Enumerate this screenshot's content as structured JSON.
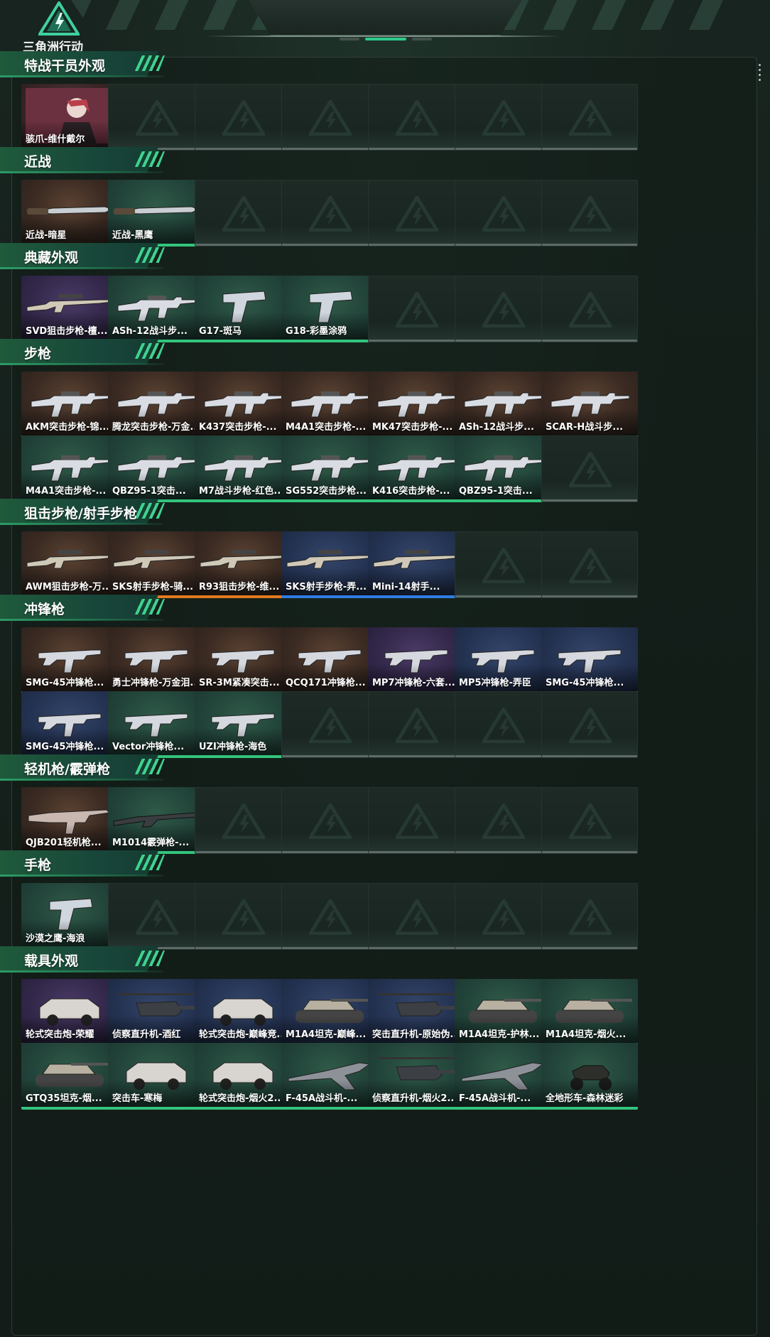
{
  "header": {
    "logo_text": "三角洲行动"
  },
  "colors": {
    "orange": "#e27a1f",
    "red": "#d2303b",
    "purple": "#8a4de0",
    "blue": "#2f7de6",
    "green": "#33c47d",
    "accent": "#2dc98a"
  },
  "sections": [
    {
      "title": "特战干员外观",
      "rows": [
        [
          {
            "label": "骇爪-维什戴尔",
            "q": "red",
            "icon": "operator-portrait"
          },
          null,
          null,
          null,
          null,
          null,
          null
        ]
      ]
    },
    {
      "title": "近战",
      "rows": [
        [
          {
            "label": "近战-暗星",
            "q": "orange",
            "icon": "knife"
          },
          {
            "label": "近战-黑鹰",
            "q": "green",
            "icon": "knife"
          },
          null,
          null,
          null,
          null,
          null
        ]
      ]
    },
    {
      "title": "典藏外观",
      "rows": [
        [
          {
            "label": "SVD狙击步枪-檀...",
            "q": "purple",
            "icon": "sniper-rifle"
          },
          {
            "label": "ASh-12战斗步...",
            "q": "green",
            "icon": "rifle"
          },
          {
            "label": "G17-斑马",
            "q": "green",
            "icon": "pistol"
          },
          {
            "label": "G18-彩墨涂鸦",
            "q": "green",
            "icon": "pistol"
          },
          null,
          null,
          null
        ]
      ]
    },
    {
      "title": "步枪",
      "rows": [
        [
          {
            "label": "AKM突击步枪-锦...",
            "q": "orange",
            "icon": "rifle"
          },
          {
            "label": "腾龙突击步枪-万金...",
            "q": "orange",
            "icon": "rifle"
          },
          {
            "label": "K437突击步枪-...",
            "q": "orange",
            "icon": "rifle"
          },
          {
            "label": "M4A1突击步枪-...",
            "q": "orange",
            "icon": "rifle"
          },
          {
            "label": "MK47突击步枪-...",
            "q": "orange",
            "icon": "rifle"
          },
          {
            "label": "ASh-12战斗步...",
            "q": "orange",
            "icon": "rifle"
          },
          {
            "label": "SCAR-H战斗步...",
            "q": "orange",
            "icon": "rifle"
          }
        ],
        [
          {
            "label": "M4A1突击步枪-...",
            "q": "green",
            "icon": "rifle"
          },
          {
            "label": "QBZ95-1突击...",
            "q": "green",
            "icon": "rifle"
          },
          {
            "label": "M7战斗步枪-红色...",
            "q": "green",
            "icon": "rifle"
          },
          {
            "label": "SG552突击步枪...",
            "q": "green",
            "icon": "rifle"
          },
          {
            "label": "K416突击步枪-...",
            "q": "green",
            "icon": "rifle"
          },
          {
            "label": "QBZ95-1突击...",
            "q": "green",
            "icon": "rifle"
          },
          null
        ]
      ]
    },
    {
      "title": "狙击步枪/射手步枪",
      "rows": [
        [
          {
            "label": "AWM狙击步枪-万...",
            "q": "orange",
            "icon": "sniper-rifle"
          },
          {
            "label": "SKS射手步枪-骑...",
            "q": "orange",
            "icon": "sniper-rifle"
          },
          {
            "label": "R93狙击步枪-维...",
            "q": "orange",
            "icon": "sniper-rifle"
          },
          {
            "label": "SKS射手步枪-弄...",
            "q": "blue",
            "icon": "sniper-rifle"
          },
          {
            "label": "Mini-14射手...",
            "q": "blue",
            "icon": "sniper-rifle"
          },
          null,
          null
        ]
      ]
    },
    {
      "title": "冲锋枪",
      "rows": [
        [
          {
            "label": "SMG-45冲锋枪...",
            "q": "orange",
            "icon": "smg"
          },
          {
            "label": "勇士冲锋枪-万金泪...",
            "q": "orange",
            "icon": "smg"
          },
          {
            "label": "SR-3M紧凑突击...",
            "q": "orange",
            "icon": "smg"
          },
          {
            "label": "QCQ171冲锋枪...",
            "q": "orange",
            "icon": "smg"
          },
          {
            "label": "MP7冲锋枪-六套...",
            "q": "purple",
            "icon": "smg"
          },
          {
            "label": "MP5冲锋枪-弄臣",
            "q": "blue",
            "icon": "smg"
          },
          {
            "label": "SMG-45冲锋枪...",
            "q": "blue",
            "icon": "smg"
          }
        ],
        [
          {
            "label": "SMG-45冲锋枪...",
            "q": "blue",
            "icon": "smg"
          },
          {
            "label": "Vector冲锋枪...",
            "q": "green",
            "icon": "smg"
          },
          {
            "label": "UZI冲锋枪-海色",
            "q": "green",
            "icon": "smg"
          },
          null,
          null,
          null,
          null
        ]
      ]
    },
    {
      "title": "轻机枪/霰弹枪",
      "rows": [
        [
          {
            "label": "QJB201轻机枪...",
            "q": "orange",
            "icon": "lmg"
          },
          {
            "label": "M1014霰弹枪-...",
            "q": "green",
            "icon": "shotgun"
          },
          null,
          null,
          null,
          null,
          null
        ]
      ]
    },
    {
      "title": "手枪",
      "rows": [
        [
          {
            "label": "沙漠之鹰-海浪",
            "q": "green",
            "icon": "pistol"
          },
          null,
          null,
          null,
          null,
          null,
          null
        ]
      ]
    },
    {
      "title": "载具外观",
      "rows": [
        [
          {
            "label": "轮式突击炮-荣耀",
            "q": "purple",
            "icon": "armored-car"
          },
          {
            "label": "侦察直升机-酒红",
            "q": "blue",
            "icon": "helicopter"
          },
          {
            "label": "轮式突击炮-巅峰竞...",
            "q": "blue",
            "icon": "armored-car"
          },
          {
            "label": "M1A4坦克-巅峰...",
            "q": "blue",
            "icon": "tank"
          },
          {
            "label": "突击直升机-原始伪...",
            "q": "blue",
            "icon": "helicopter"
          },
          {
            "label": "M1A4坦克-护林...",
            "q": "green",
            "icon": "tank"
          },
          {
            "label": "M1A4坦克-烟火...",
            "q": "green",
            "icon": "tank"
          }
        ],
        [
          {
            "label": "GTQ35坦克-烟...",
            "q": "green",
            "icon": "tank"
          },
          {
            "label": "突击车-寒梅",
            "q": "green",
            "icon": "armored-car"
          },
          {
            "label": "轮式突击炮-烟火2...",
            "q": "green",
            "icon": "armored-car"
          },
          {
            "label": "F-45A战斗机-...",
            "q": "green",
            "icon": "jet"
          },
          {
            "label": "侦察直升机-烟火2...",
            "q": "green",
            "icon": "helicopter"
          },
          {
            "label": "F-45A战斗机-...",
            "q": "green",
            "icon": "jet"
          },
          {
            "label": "全地形车-森林迷彩",
            "q": "green",
            "icon": "atv"
          }
        ]
      ]
    }
  ]
}
